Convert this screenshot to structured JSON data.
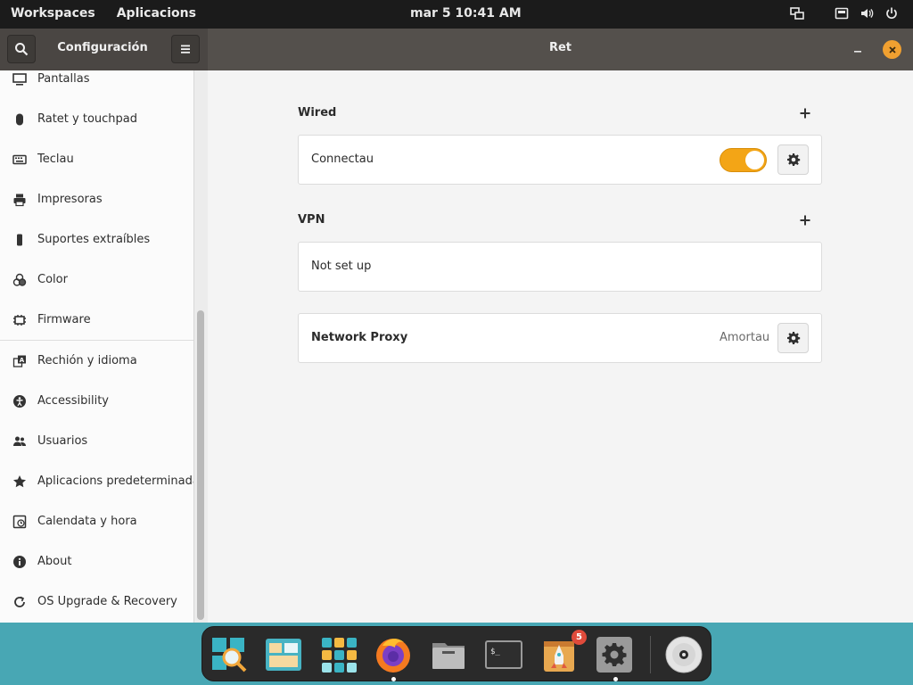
{
  "topbar": {
    "workspaces": "Workspaces",
    "applications": "Aplicacions",
    "clock": "mar 5  10:41 AM"
  },
  "window": {
    "sidebar_title": "Configuración",
    "main_title": "Ret"
  },
  "sidebar": {
    "items": [
      {
        "label": "Pantallas",
        "icon": "display-icon"
      },
      {
        "label": "Ratet y touchpad",
        "icon": "mouse-icon"
      },
      {
        "label": "Teclau",
        "icon": "keyboard-icon"
      },
      {
        "label": "Impresoras",
        "icon": "printer-icon"
      },
      {
        "label": "Suportes extraíbles",
        "icon": "removable-media-icon"
      },
      {
        "label": "Color",
        "icon": "color-icon"
      },
      {
        "label": "Firmware",
        "icon": "firmware-icon"
      },
      {
        "label": "Rechión y idioma",
        "icon": "region-language-icon"
      },
      {
        "label": "Accessibility",
        "icon": "accessibility-icon"
      },
      {
        "label": "Usuarios",
        "icon": "users-icon"
      },
      {
        "label": "Aplicacions predeterminadas",
        "icon": "star-icon"
      },
      {
        "label": "Calendata y hora",
        "icon": "clock-icon"
      },
      {
        "label": "About",
        "icon": "info-icon"
      },
      {
        "label": "OS Upgrade & Recovery",
        "icon": "upgrade-recovery-icon"
      }
    ]
  },
  "main": {
    "wired": {
      "title": "Wired",
      "connection_label": "Connectau",
      "toggle_on": true
    },
    "vpn": {
      "title": "VPN",
      "status": "Not set up"
    },
    "proxy": {
      "label": "Network Proxy",
      "value": "Amortau"
    }
  },
  "dock": {
    "items": [
      {
        "name": "search-app",
        "icon": "magnifier-icon"
      },
      {
        "name": "workspaces-app",
        "icon": "workspaces-icon"
      },
      {
        "name": "app-grid",
        "icon": "app-grid-icon"
      },
      {
        "name": "firefox",
        "icon": "firefox-icon"
      },
      {
        "name": "files",
        "icon": "files-icon"
      },
      {
        "name": "terminal",
        "icon": "terminal-icon"
      },
      {
        "name": "pop-shop",
        "icon": "shop-icon"
      },
      {
        "name": "settings",
        "icon": "settings-icon"
      },
      {
        "name": "disc",
        "icon": "disc-icon"
      }
    ],
    "shop_badge": "5"
  },
  "colors": {
    "accent": "#f3a516",
    "close": "#f0a030",
    "badge": "#e04b3b",
    "desktop": "#48a7b4"
  }
}
